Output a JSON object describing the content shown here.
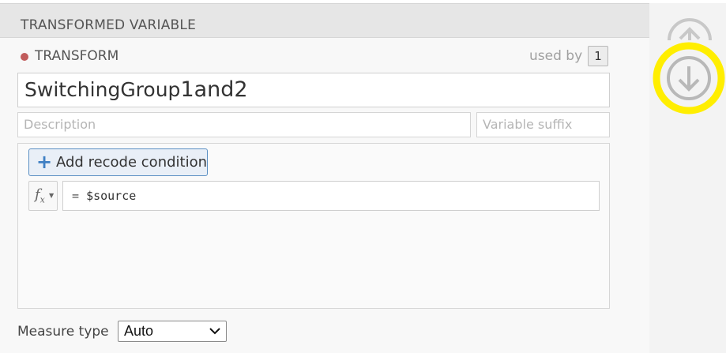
{
  "panel": {
    "title": "TRANSFORMED VARIABLE"
  },
  "transform": {
    "label": "TRANSFORM",
    "status_color": "#c15c5c",
    "used_by_label": "used by",
    "used_by_count": "1",
    "name_base": "SwitchingGroup",
    "name_suffix": "1and2",
    "description_placeholder": "Description",
    "suffix_placeholder": "Variable suffix"
  },
  "recode": {
    "add_button_label": "Add recode condition",
    "add_icon": "plus-icon",
    "fx_icon": "function-icon",
    "formula_eq": "=",
    "formula_value": "$source"
  },
  "measure": {
    "label": "Measure type",
    "selected": "Auto"
  },
  "nav": {
    "up_icon": "arrow-up-circle-icon",
    "down_icon": "arrow-down-circle-icon",
    "highlight_color": "#ffee00"
  }
}
